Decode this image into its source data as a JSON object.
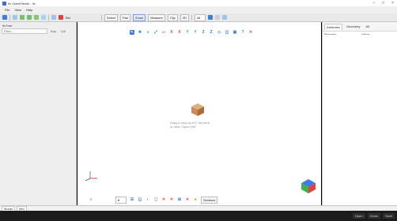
{
  "window": {
    "title": "Ifc OpenViewer - ifc"
  },
  "menu": [
    "File",
    "View",
    "Help"
  ],
  "toolbar": {
    "items_left": [
      "Bld"
    ],
    "labels": [
      "Select",
      "Pan",
      "Zoom",
      "Measure",
      "Clip",
      "2D"
    ],
    "view_select": "All"
  },
  "left_panel": {
    "title": "IfcTree",
    "filter_placeholder": "Filter...",
    "buttons": [
      "Exp",
      "Col"
    ]
  },
  "viewport": {
    "empty_line1": "Drag & drop an IFC file here",
    "empty_line2": "or click \"Open File\"",
    "bottom_label": "Sections"
  },
  "right_panel": {
    "tabs": [
      "Attributes",
      "Geometry",
      "All"
    ],
    "active_tab": "Attributes",
    "columns": [
      "Property",
      "Value"
    ]
  },
  "bottom_tabs": [
    "Model",
    "Info"
  ],
  "status": {
    "buttons": [
      "Open",
      "Close",
      "Save"
    ]
  },
  "colors": {
    "accent": "#3a7de0",
    "cube": "#c98a55",
    "red_x": "#e04040",
    "green": "#3cb44a"
  }
}
